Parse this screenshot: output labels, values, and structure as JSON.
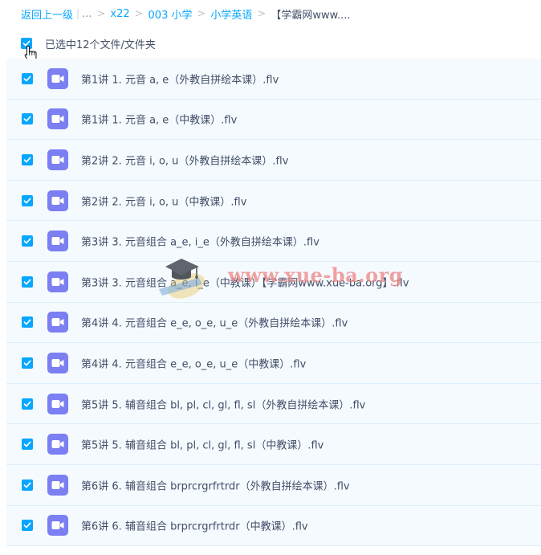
{
  "breadcrumb": {
    "back": "返回上一级",
    "ellipsis": "...",
    "items": [
      "x22",
      "003 小学",
      "小学英语"
    ],
    "current": "【学霸网www...."
  },
  "selection": {
    "label": "已选中12个文件/文件夹"
  },
  "files": [
    {
      "name": "第1讲 1. 元音 a, e（外教自拼绘本课）.flv"
    },
    {
      "name": "第1讲 1. 元音 a, e（中教课）.flv"
    },
    {
      "name": "第2讲 2. 元音 i, o, u（外教自拼绘本课）.flv"
    },
    {
      "name": "第2讲 2. 元音 i, o, u（中教课）.flv"
    },
    {
      "name": "第3讲 3. 元音组合 a_e, i_e（外教自拼绘本课）.flv"
    },
    {
      "name": "第3讲 3. 元音组合 a_e, i_e（中教课）【学霸网www.xue-ba.org】.flv"
    },
    {
      "name": "第4讲 4. 元音组合 e_e, o_e, u_e（外教自拼绘本课）.flv"
    },
    {
      "name": "第4讲 4. 元音组合 e_e, o_e, u_e（中教课）.flv"
    },
    {
      "name": "第5讲 5. 辅音组合 bl, pl, cl, gl, fl, sl（外教自拼绘本课）.flv"
    },
    {
      "name": "第5讲 5. 辅音组合 bl, pl, cl, gl, fl, sl（中教课）.flv"
    },
    {
      "name": "第6讲 6. 辅音组合 brprcrgrfrtrdr（外教自拼绘本课）.flv"
    },
    {
      "name": "第6讲 6. 辅音组合 brprcrgrfrtrdr（中教课）.flv"
    }
  ],
  "watermark": {
    "text": "www.xue-ba.org"
  },
  "icons": {
    "checkbox": "checkmark-icon",
    "file": "video-file-icon",
    "cursor": "hand-pointer-icon",
    "watermark": "graduation-cap-icon"
  },
  "colors": {
    "accent": "#06a7ff",
    "file_icon": "#7b7ff2",
    "row_bg": "#f5fafe",
    "row_border": "#dceefb",
    "text": "#424e67",
    "watermark": "#f08a8a"
  }
}
